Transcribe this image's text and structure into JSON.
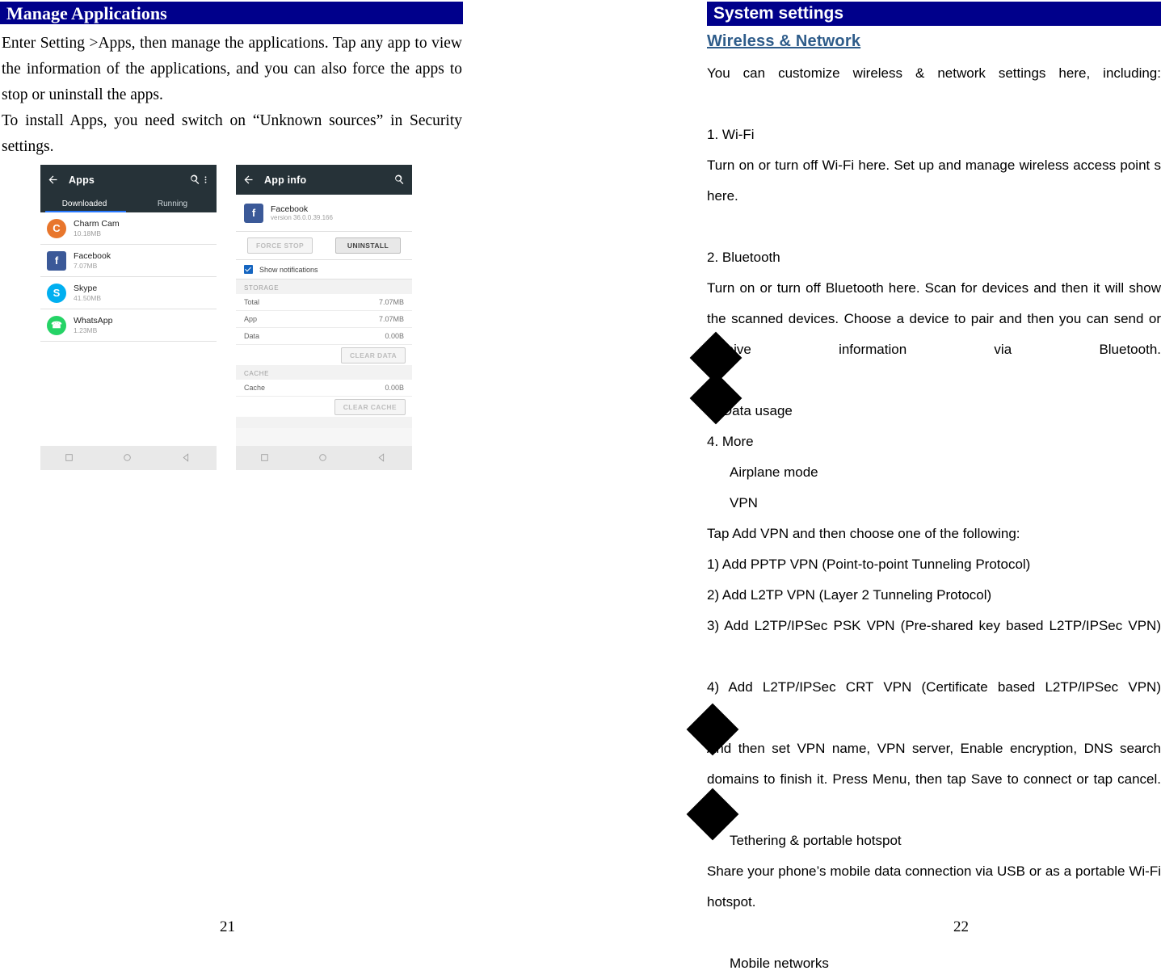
{
  "left_page": {
    "header": "Manage Applications",
    "paragraphs": [
      "Enter Setting >Apps, then manage the applications. Tap any app to view the information of the applications, and you can also force the apps to stop or uninstall the apps.",
      "To install Apps, you need switch on “Unknown sources” in Security settings."
    ],
    "page_number": "21",
    "screenshot_apps": {
      "title": "Apps",
      "back_icon": "back-arrow-icon",
      "search_icon": "search-icon",
      "overflow_icon": "overflow-menu-icon",
      "tabs": [
        {
          "label": "Downloaded",
          "selected": true
        },
        {
          "label": "Running",
          "selected": false
        }
      ],
      "apps": [
        {
          "name": "Charm Cam",
          "size": "10.18MB",
          "initial": "C",
          "color": "#E8762C"
        },
        {
          "name": "Facebook",
          "size": "7.07MB",
          "initial": "f",
          "color": "#3B5998"
        },
        {
          "name": "Skype",
          "size": "41.50MB",
          "initial": "S",
          "color": "#00AFF0"
        },
        {
          "name": "WhatsApp",
          "size": "1.23MB",
          "initial": "✆",
          "color": "#25D366"
        }
      ],
      "nav": [
        "square-icon",
        "circle-icon",
        "back-triangle-icon"
      ]
    },
    "screenshot_appinfo": {
      "title": "App info",
      "back_icon": "back-arrow-icon",
      "search_icon": "search-icon",
      "app_name": "Facebook",
      "app_version": "version 36.0.0.39.166",
      "app_initial": "f",
      "app_color": "#3B5998",
      "force_stop_label": "FORCE STOP",
      "uninstall_label": "UNINSTALL",
      "show_notifications_label": "Show notifications",
      "storage_label": "STORAGE",
      "storage_rows": [
        {
          "key": "Total",
          "value": "7.07MB"
        },
        {
          "key": "App",
          "value": "7.07MB"
        },
        {
          "key": "Data",
          "value": "0.00B"
        }
      ],
      "clear_data_label": "CLEAR DATA",
      "cache_label": "CACHE",
      "cache_rows": [
        {
          "key": "Cache",
          "value": "0.00B"
        }
      ],
      "clear_cache_label": "CLEAR CACHE",
      "nav": [
        "square-icon",
        "circle-icon",
        "back-triangle-icon"
      ]
    }
  },
  "right_page": {
    "header": "System settings",
    "subheader": "Wireless & Network",
    "paragraphs": [
      {
        "text": "You can customize wireless & network settings here, including:",
        "style": "just"
      },
      {
        "text": "1. Wi-Fi",
        "style": "plain"
      },
      {
        "text": "Turn on or turn off Wi-Fi here. Set up and manage wireless access point s here.",
        "style": "just"
      },
      {
        "text": "2. Bluetooth",
        "style": "plain"
      },
      {
        "text": "Turn on or turn off Bluetooth here. Scan for devices and then it will show the scanned devices. Choose a device to pair and then you can send or receive information via Bluetooth.",
        "style": "just"
      },
      {
        "text": "3. Data usage",
        "style": "plain"
      },
      {
        "text": "4. More",
        "style": "plain"
      },
      {
        "text": "Airplane mode",
        "style": "indent"
      },
      {
        "text": "VPN",
        "style": "indent"
      },
      {
        "text": "Tap Add VPN and then choose one of the following:",
        "style": "plain"
      },
      {
        "text": "1) Add PPTP VPN (Point-to-point Tunneling Protocol)",
        "style": "plain"
      },
      {
        "text": "2) Add L2TP VPN (Layer 2 Tunneling Protocol)",
        "style": "plain"
      },
      {
        "text": "3) Add L2TP/IPSec PSK VPN (Pre-shared key based L2TP/IPSec VPN)",
        "style": "just"
      },
      {
        "text": "4) Add L2TP/IPSec CRT VPN (Certificate based L2TP/IPSec VPN)",
        "style": "just"
      },
      {
        "text": "And then set VPN name, VPN server, Enable encryption, DNS search domains to finish it. Press Menu, then tap Save to connect or tap cancel.",
        "style": "just"
      },
      {
        "text": "Tethering & portable hotspot",
        "style": "indent"
      },
      {
        "text": "Share your phone’s mobile data connection via USB or as a portable Wi-Fi hotspot.",
        "style": "just"
      },
      {
        "text": "Mobile networks",
        "style": "indent"
      }
    ],
    "page_number": "22"
  }
}
